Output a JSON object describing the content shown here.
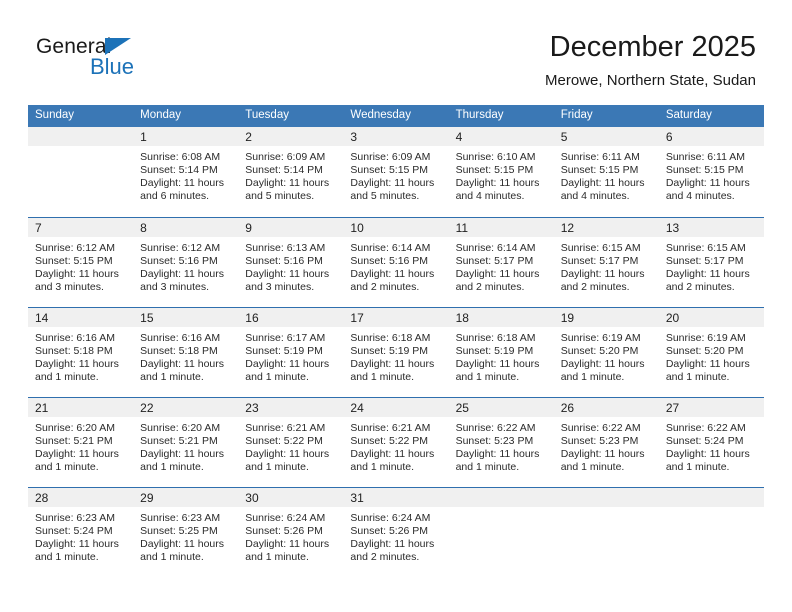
{
  "brand": {
    "name_top": "General",
    "name_bottom": "Blue",
    "accent_color": "#1c72b8"
  },
  "header": {
    "title": "December 2025",
    "subtitle": "Merowe, Northern State, Sudan"
  },
  "theme": {
    "header_blue": "#3b78b5",
    "row_divider_blue": "#2f6fae",
    "daynum_band": "#f0f0f0",
    "text": "#2b2b2b"
  },
  "weekdays": [
    "Sunday",
    "Monday",
    "Tuesday",
    "Wednesday",
    "Thursday",
    "Friday",
    "Saturday"
  ],
  "weeks": [
    [
      {
        "day": "",
        "empty": true,
        "sunrise": "",
        "sunset": "",
        "daylight1": "",
        "daylight2": ""
      },
      {
        "day": "1",
        "sunrise": "Sunrise: 6:08 AM",
        "sunset": "Sunset: 5:14 PM",
        "daylight1": "Daylight: 11 hours",
        "daylight2": "and 6 minutes."
      },
      {
        "day": "2",
        "sunrise": "Sunrise: 6:09 AM",
        "sunset": "Sunset: 5:14 PM",
        "daylight1": "Daylight: 11 hours",
        "daylight2": "and 5 minutes."
      },
      {
        "day": "3",
        "sunrise": "Sunrise: 6:09 AM",
        "sunset": "Sunset: 5:15 PM",
        "daylight1": "Daylight: 11 hours",
        "daylight2": "and 5 minutes."
      },
      {
        "day": "4",
        "sunrise": "Sunrise: 6:10 AM",
        "sunset": "Sunset: 5:15 PM",
        "daylight1": "Daylight: 11 hours",
        "daylight2": "and 4 minutes."
      },
      {
        "day": "5",
        "sunrise": "Sunrise: 6:11 AM",
        "sunset": "Sunset: 5:15 PM",
        "daylight1": "Daylight: 11 hours",
        "daylight2": "and 4 minutes."
      },
      {
        "day": "6",
        "sunrise": "Sunrise: 6:11 AM",
        "sunset": "Sunset: 5:15 PM",
        "daylight1": "Daylight: 11 hours",
        "daylight2": "and 4 minutes."
      }
    ],
    [
      {
        "day": "7",
        "sunrise": "Sunrise: 6:12 AM",
        "sunset": "Sunset: 5:15 PM",
        "daylight1": "Daylight: 11 hours",
        "daylight2": "and 3 minutes."
      },
      {
        "day": "8",
        "sunrise": "Sunrise: 6:12 AM",
        "sunset": "Sunset: 5:16 PM",
        "daylight1": "Daylight: 11 hours",
        "daylight2": "and 3 minutes."
      },
      {
        "day": "9",
        "sunrise": "Sunrise: 6:13 AM",
        "sunset": "Sunset: 5:16 PM",
        "daylight1": "Daylight: 11 hours",
        "daylight2": "and 3 minutes."
      },
      {
        "day": "10",
        "sunrise": "Sunrise: 6:14 AM",
        "sunset": "Sunset: 5:16 PM",
        "daylight1": "Daylight: 11 hours",
        "daylight2": "and 2 minutes."
      },
      {
        "day": "11",
        "sunrise": "Sunrise: 6:14 AM",
        "sunset": "Sunset: 5:17 PM",
        "daylight1": "Daylight: 11 hours",
        "daylight2": "and 2 minutes."
      },
      {
        "day": "12",
        "sunrise": "Sunrise: 6:15 AM",
        "sunset": "Sunset: 5:17 PM",
        "daylight1": "Daylight: 11 hours",
        "daylight2": "and 2 minutes."
      },
      {
        "day": "13",
        "sunrise": "Sunrise: 6:15 AM",
        "sunset": "Sunset: 5:17 PM",
        "daylight1": "Daylight: 11 hours",
        "daylight2": "and 2 minutes."
      }
    ],
    [
      {
        "day": "14",
        "sunrise": "Sunrise: 6:16 AM",
        "sunset": "Sunset: 5:18 PM",
        "daylight1": "Daylight: 11 hours",
        "daylight2": "and 1 minute."
      },
      {
        "day": "15",
        "sunrise": "Sunrise: 6:16 AM",
        "sunset": "Sunset: 5:18 PM",
        "daylight1": "Daylight: 11 hours",
        "daylight2": "and 1 minute."
      },
      {
        "day": "16",
        "sunrise": "Sunrise: 6:17 AM",
        "sunset": "Sunset: 5:19 PM",
        "daylight1": "Daylight: 11 hours",
        "daylight2": "and 1 minute."
      },
      {
        "day": "17",
        "sunrise": "Sunrise: 6:18 AM",
        "sunset": "Sunset: 5:19 PM",
        "daylight1": "Daylight: 11 hours",
        "daylight2": "and 1 minute."
      },
      {
        "day": "18",
        "sunrise": "Sunrise: 6:18 AM",
        "sunset": "Sunset: 5:19 PM",
        "daylight1": "Daylight: 11 hours",
        "daylight2": "and 1 minute."
      },
      {
        "day": "19",
        "sunrise": "Sunrise: 6:19 AM",
        "sunset": "Sunset: 5:20 PM",
        "daylight1": "Daylight: 11 hours",
        "daylight2": "and 1 minute."
      },
      {
        "day": "20",
        "sunrise": "Sunrise: 6:19 AM",
        "sunset": "Sunset: 5:20 PM",
        "daylight1": "Daylight: 11 hours",
        "daylight2": "and 1 minute."
      }
    ],
    [
      {
        "day": "21",
        "sunrise": "Sunrise: 6:20 AM",
        "sunset": "Sunset: 5:21 PM",
        "daylight1": "Daylight: 11 hours",
        "daylight2": "and 1 minute."
      },
      {
        "day": "22",
        "sunrise": "Sunrise: 6:20 AM",
        "sunset": "Sunset: 5:21 PM",
        "daylight1": "Daylight: 11 hours",
        "daylight2": "and 1 minute."
      },
      {
        "day": "23",
        "sunrise": "Sunrise: 6:21 AM",
        "sunset": "Sunset: 5:22 PM",
        "daylight1": "Daylight: 11 hours",
        "daylight2": "and 1 minute."
      },
      {
        "day": "24",
        "sunrise": "Sunrise: 6:21 AM",
        "sunset": "Sunset: 5:22 PM",
        "daylight1": "Daylight: 11 hours",
        "daylight2": "and 1 minute."
      },
      {
        "day": "25",
        "sunrise": "Sunrise: 6:22 AM",
        "sunset": "Sunset: 5:23 PM",
        "daylight1": "Daylight: 11 hours",
        "daylight2": "and 1 minute."
      },
      {
        "day": "26",
        "sunrise": "Sunrise: 6:22 AM",
        "sunset": "Sunset: 5:23 PM",
        "daylight1": "Daylight: 11 hours",
        "daylight2": "and 1 minute."
      },
      {
        "day": "27",
        "sunrise": "Sunrise: 6:22 AM",
        "sunset": "Sunset: 5:24 PM",
        "daylight1": "Daylight: 11 hours",
        "daylight2": "and 1 minute."
      }
    ],
    [
      {
        "day": "28",
        "sunrise": "Sunrise: 6:23 AM",
        "sunset": "Sunset: 5:24 PM",
        "daylight1": "Daylight: 11 hours",
        "daylight2": "and 1 minute."
      },
      {
        "day": "29",
        "sunrise": "Sunrise: 6:23 AM",
        "sunset": "Sunset: 5:25 PM",
        "daylight1": "Daylight: 11 hours",
        "daylight2": "and 1 minute."
      },
      {
        "day": "30",
        "sunrise": "Sunrise: 6:24 AM",
        "sunset": "Sunset: 5:26 PM",
        "daylight1": "Daylight: 11 hours",
        "daylight2": "and 1 minute."
      },
      {
        "day": "31",
        "sunrise": "Sunrise: 6:24 AM",
        "sunset": "Sunset: 5:26 PM",
        "daylight1": "Daylight: 11 hours",
        "daylight2": "and 2 minutes."
      },
      {
        "day": "",
        "empty": true,
        "sunrise": "",
        "sunset": "",
        "daylight1": "",
        "daylight2": ""
      },
      {
        "day": "",
        "empty": true,
        "sunrise": "",
        "sunset": "",
        "daylight1": "",
        "daylight2": ""
      },
      {
        "day": "",
        "empty": true,
        "sunrise": "",
        "sunset": "",
        "daylight1": "",
        "daylight2": ""
      }
    ]
  ]
}
